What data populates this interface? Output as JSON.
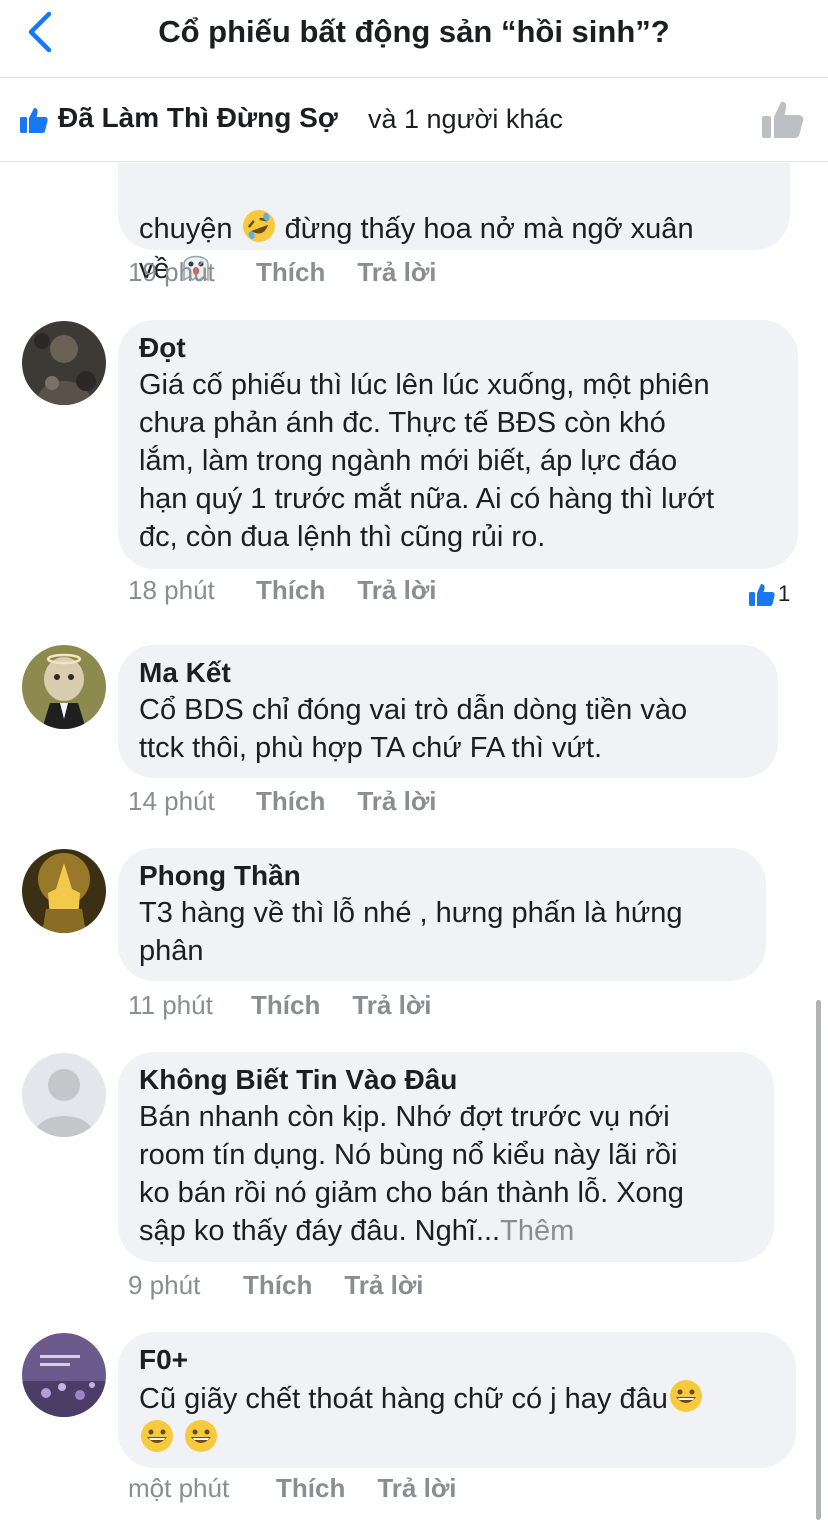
{
  "header": {
    "title": "Cổ phiếu bất động sản “hồi sinh”?"
  },
  "likes": {
    "first_liker": "Đã Làm Thì Đừng Sợ",
    "others_text": "và 1 người khác"
  },
  "comments": [
    {
      "name": "",
      "text": "chuyện  đừng thấy hoa nở mà ngỡ xuân\nvề ",
      "time": "19 phút",
      "like": "Thích",
      "reply": "Trả lời"
    },
    {
      "name": "Đọt",
      "text": "Giá cố phiếu thì lúc lên lúc xuống, một phiên\nchưa phản ánh đc. Thực tế BĐS còn khó\nlắm, làm trong ngành mới biết, áp lực đáo\nhạn quý 1 trước mắt nữa. Ai có hàng thì lướt\nđc, còn đua lệnh thì cũng rủi ro.",
      "time": "18 phút",
      "like": "Thích",
      "reply": "Trả lời",
      "reaction_count": "1"
    },
    {
      "name": "Ma Kết",
      "text": "Cổ BDS chỉ đóng vai trò dẫn dòng tiền vào\nttck thôi, phù hợp TA chứ FA thì vứt.",
      "time": "14 phút",
      "like": "Thích",
      "reply": "Trả lời"
    },
    {
      "name": "Phong Thần",
      "text": "T3 hàng về thì lỗ nhé , hưng phấn là hứng\nphân",
      "time": "11 phút",
      "like": "Thích",
      "reply": "Trả lời"
    },
    {
      "name": "Không Biết Tin Vào Đâu",
      "text": "Bán nhanh còn kịp. Nhớ đợt trước vụ nới\nroom tín dụng. Nó bùng nổ kiểu này lãi rồi\nko bán rồi nó giảm cho bán thành lỗ. Xong\nsập ko thấy đáy đâu. Nghĩ...",
      "more": "Thêm",
      "time": "9 phút",
      "like": "Thích",
      "reply": "Trả lời"
    },
    {
      "name": "F0+",
      "text": "Cũ giãy chết thoát hàng chữ có j hay đâu",
      "time": "một phút",
      "like": "Thích",
      "reply": "Trả lời"
    }
  ],
  "colors": {
    "accent": "#1877f2",
    "bubble": "#f0f2f5",
    "meta": "#8a8d91"
  }
}
